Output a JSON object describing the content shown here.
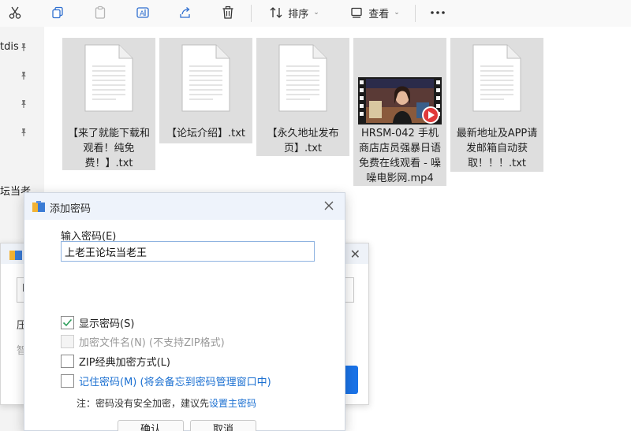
{
  "toolbar": {
    "sort_label": "排序",
    "view_label": "查看"
  },
  "nav": {
    "items": [
      "tdis",
      "坛当老",
      "压",
      "智"
    ]
  },
  "files": [
    {
      "name": "【来了就能下载和观看！纯免费！】.txt",
      "type": "txt"
    },
    {
      "name": "【论坛介绍】.txt",
      "type": "txt"
    },
    {
      "name": "【永久地址发布页】.txt",
      "type": "txt"
    },
    {
      "name": "HRSM-042 手机商店店员强暴日语免费在线观看 - 噪噪电影网.mp4",
      "type": "video"
    },
    {
      "name": "最新地址及APP请发邮箱自动获取！！！.txt",
      "type": "txt"
    }
  ],
  "bg_dialog": {
    "input_value": "H",
    "line1": "压",
    "line2": "智"
  },
  "dialog": {
    "title": "添加密码",
    "field_label": "输入密码(E)",
    "password_value": "上老王论坛当老王",
    "options": [
      {
        "label": "显示密码(S)",
        "checked": true,
        "disabled": false,
        "link": false
      },
      {
        "label": "加密文件名(N) (不支持ZIP格式)",
        "checked": false,
        "disabled": true,
        "link": false
      },
      {
        "label": "ZIP经典加密方式(L)",
        "checked": false,
        "disabled": false,
        "link": false
      },
      {
        "label": "记住密码(M) (将会备忘到密码管理窗口中)",
        "checked": false,
        "disabled": false,
        "link": true
      }
    ],
    "note_prefix": "注：密码没有安全加密，建议先",
    "note_link": "设置主密码",
    "ok_label": "确认",
    "cancel_label": "取消"
  },
  "colors": {
    "accent": "#1a73e8",
    "link": "#1a6fd1",
    "check": "#2e9e5b"
  }
}
